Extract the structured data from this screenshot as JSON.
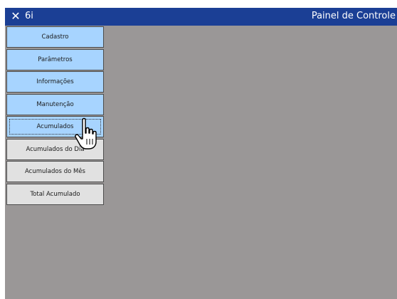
{
  "titlebar": {
    "close_icon": "close-icon",
    "app_name": "6i",
    "title": "Painel de Controle"
  },
  "menu": {
    "items": [
      {
        "label": "Cadastro",
        "state": "blue"
      },
      {
        "label": "Parâmetros",
        "state": "blue"
      },
      {
        "label": "Informações",
        "state": "blue"
      },
      {
        "label": "Manutenção",
        "state": "blue"
      },
      {
        "label": "Acumulados",
        "state": "blue-selected"
      },
      {
        "label": "Acumulados do Dia",
        "state": "gray"
      },
      {
        "label": "Acumulados do Mês",
        "state": "gray"
      },
      {
        "label": "Total Acumulado",
        "state": "gray"
      }
    ]
  },
  "cursor": {
    "icon": "hand-pointer-icon"
  },
  "colors": {
    "titlebar": "#1b3f95",
    "background": "#9a9797",
    "menu_active": "#a7d4ff",
    "menu_inactive": "#e1e1e1"
  }
}
